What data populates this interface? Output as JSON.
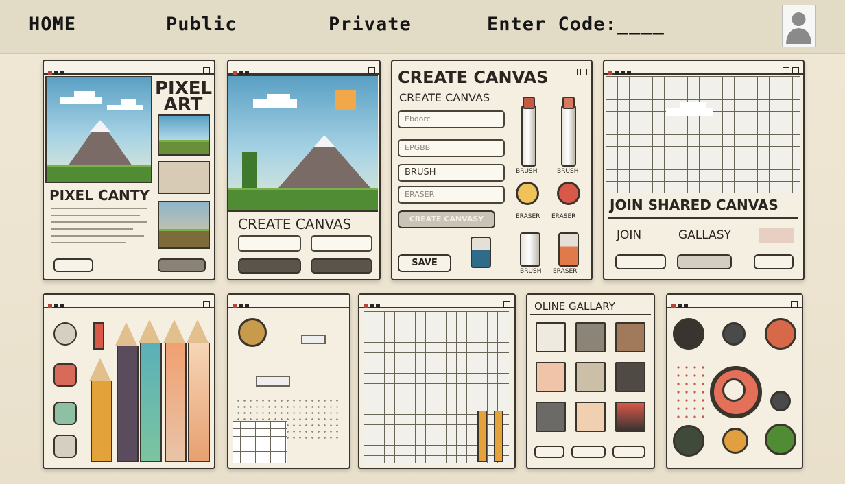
{
  "nav": {
    "home": "HOME",
    "public": "Public",
    "private": "Private",
    "enter_code": "Enter Code:____"
  },
  "panels": {
    "pixel_art": {
      "title": "PIXEL ART",
      "subtitle": "PIXEL CANTY"
    },
    "create_canvas_preview": {
      "heading": "CREATE CANVAS"
    },
    "create_canvas_form": {
      "heading": "CREATE CANVAS",
      "subheading": "CREATE CANVAS",
      "field1": "Eboorc",
      "field2": "EPGBB",
      "field3": "BRUSH",
      "field4": "ERASER",
      "create_button": "CREATE CANVASY",
      "save_button": "SAVE",
      "tool_labels": [
        "BRUSH",
        "BRUSH",
        "ERASER",
        "ERASER",
        "BRUSH",
        "ERASER"
      ]
    },
    "join_shared": {
      "heading": "JOIN SHARED CANVAS",
      "join": "JOIN",
      "gallery": "GALLASY"
    },
    "online_gallery": {
      "heading": "OLINE GALLARY"
    }
  },
  "colors": {
    "background": "#ece4d0",
    "topbar": "#e2dcc6",
    "panel": "#f4efe1",
    "outline": "#39342c",
    "accent_red": "#c45a44"
  },
  "icons": [
    "user-avatar-icon",
    "window-dots-icon",
    "window-controls-icon",
    "pencil-icon",
    "paint-tube-icon"
  ]
}
